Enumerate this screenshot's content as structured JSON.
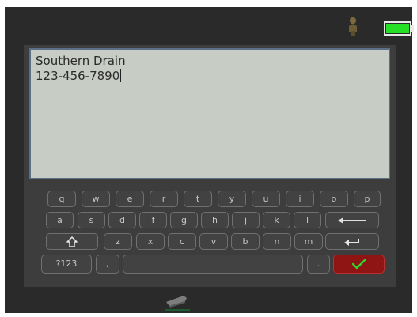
{
  "text_field": {
    "lines": [
      "Southern Drain",
      "123-456-7890"
    ]
  },
  "keyboard": {
    "row1": [
      "q",
      "w",
      "e",
      "r",
      "t",
      "y",
      "u",
      "i",
      "o",
      "p"
    ],
    "row2": [
      "a",
      "s",
      "d",
      "f",
      "g",
      "h",
      "j",
      "k",
      "l"
    ],
    "row3": [
      "z",
      "x",
      "c",
      "v",
      "b",
      "n",
      "m"
    ],
    "symbols_label": "?123",
    "comma_label": ",",
    "period_label": "."
  },
  "icons": {
    "status_person": "person-icon",
    "battery": "battery-icon",
    "backspace": "backspace-icon",
    "shift": "shift-icon",
    "enter": "enter-icon",
    "confirm": "checkmark-icon",
    "footer": "device-icon"
  },
  "colors": {
    "battery": "#26e026",
    "confirm_key": "#8f1414",
    "checkmark": "#2fd52f",
    "text_area_bg": "#c7ccc5",
    "text_area_border": "#5b6f86",
    "screen_bg": "#2a2a2a"
  }
}
